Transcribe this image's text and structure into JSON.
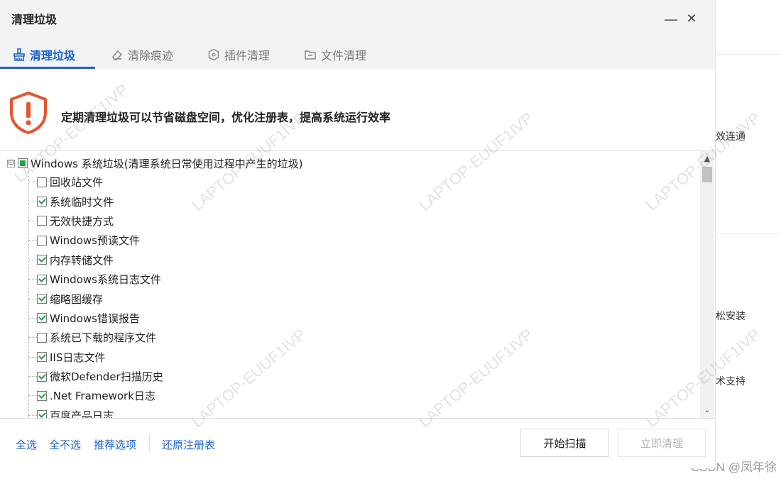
{
  "dialog": {
    "title": "清理垃圾",
    "minimize_glyph": "—",
    "close_glyph": "✕",
    "tabs": [
      {
        "label": "清理垃圾",
        "icon": "broom-icon",
        "active": true
      },
      {
        "label": "清除痕迹",
        "icon": "eraser-icon",
        "active": false
      },
      {
        "label": "插件清理",
        "icon": "plugin-shield-icon",
        "active": false
      },
      {
        "label": "文件清理",
        "icon": "folder-icon",
        "active": false
      }
    ],
    "accent_color": "#1a62d0"
  },
  "notice": {
    "icon": "warning-shield-icon",
    "text": "定期清理垃圾可以节省磁盘空间，优化注册表，提高系统运行效率"
  },
  "tree": {
    "root": {
      "label": "Windows 系统垃圾(清理系统日常使用过程中产生的垃圾)",
      "state": "partial",
      "expander": "⊟"
    },
    "items": [
      {
        "label": "回收站文件",
        "checked": false
      },
      {
        "label": "系统临时文件",
        "checked": true
      },
      {
        "label": "无效快捷方式",
        "checked": false
      },
      {
        "label": "Windows预读文件",
        "checked": false
      },
      {
        "label": "内存转储文件",
        "checked": true
      },
      {
        "label": "Windows系统日志文件",
        "checked": true
      },
      {
        "label": "缩略图缓存",
        "checked": true
      },
      {
        "label": "Windows错误报告",
        "checked": true
      },
      {
        "label": "系统已下载的程序文件",
        "checked": false
      },
      {
        "label": "IIS日志文件",
        "checked": true
      },
      {
        "label": "微软Defender扫描历史",
        "checked": true
      },
      {
        "label": ".Net Framework日志",
        "checked": true
      },
      {
        "label": "百度产品日志",
        "checked": true
      }
    ],
    "scroll_up": "▲",
    "scroll_down": "⌄"
  },
  "footer": {
    "select_all": "全选",
    "select_none": "全不选",
    "recommended": "推荐选项",
    "restore_registry": "还原注册表",
    "start_scan": "开始扫描",
    "clean_now": "立即清理"
  },
  "background": {
    "fragments": [
      "效连通",
      "松安装",
      "术支持"
    ]
  },
  "watermark": "LAPTOP-EUUF1IVP",
  "credit": "CSDN @凤年徐"
}
